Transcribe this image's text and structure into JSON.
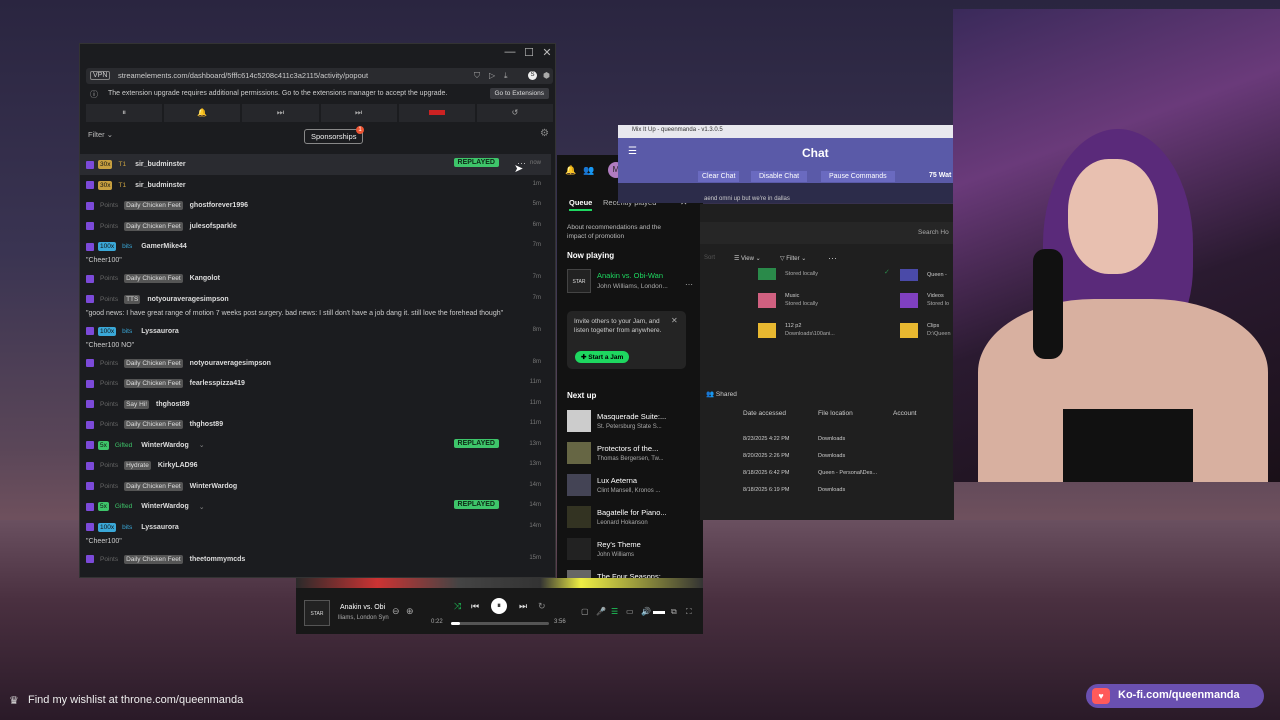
{
  "streamelements": {
    "url": "streamelements.com/dashboard/5fffc614c5208c411c3a2115/activity/popout",
    "vpn": "VPN",
    "notice": "The extension upgrade requires additional permissions. Go to the extensions manager to accept the upgrade.",
    "notice_button": "Go to Extensions",
    "filter": "Filter",
    "sponsorships": "Sponsorships",
    "badge_count": "1",
    "feed": [
      {
        "b1": "30x",
        "b2": "T1",
        "name": "sir_budminster",
        "msg": "",
        "time": "now",
        "replayed": "REPLAYED",
        "kind": "sub"
      },
      {
        "b1": "30x",
        "b2": "T1",
        "name": "sir_budminster",
        "msg": "",
        "time": "1m",
        "replayed": "",
        "kind": "sub"
      },
      {
        "b1": "Points",
        "b2": "Daily Chicken Feet",
        "name": "ghostforever1996",
        "msg": "",
        "time": "5m",
        "replayed": "",
        "kind": "points"
      },
      {
        "b1": "Points",
        "b2": "Daily Chicken Feet",
        "name": "julesofsparkle",
        "msg": "",
        "time": "6m",
        "replayed": "",
        "kind": "points"
      },
      {
        "b1": "100x",
        "b2": "bits",
        "name": "GamerMike44",
        "msg": "\"Cheer100\"",
        "time": "7m",
        "replayed": "",
        "kind": "bits"
      },
      {
        "b1": "Points",
        "b2": "Daily Chicken Feet",
        "name": "Kangolot",
        "msg": "",
        "time": "7m",
        "replayed": "",
        "kind": "points"
      },
      {
        "b1": "Points",
        "b2": "TTS",
        "name": "notyouraveragesimpson",
        "msg": "\"good news: I have great range of motion 7 weeks post surgery. bad news: I still don't have a job dang it. still love the forehead though\"",
        "time": "7m",
        "replayed": "",
        "kind": "points"
      },
      {
        "b1": "100x",
        "b2": "bits",
        "name": "Lyssaurora",
        "msg": "\"Cheer100 NO\"",
        "time": "8m",
        "replayed": "",
        "kind": "bits"
      },
      {
        "b1": "Points",
        "b2": "Daily Chicken Feet",
        "name": "notyouraveragesimpson",
        "msg": "",
        "time": "8m",
        "replayed": "",
        "kind": "points"
      },
      {
        "b1": "Points",
        "b2": "Daily Chicken Feet",
        "name": "fearlesspizza419",
        "msg": "",
        "time": "11m",
        "replayed": "",
        "kind": "points"
      },
      {
        "b1": "Points",
        "b2": "Say Hi!",
        "name": "thghost89",
        "msg": "",
        "time": "11m",
        "replayed": "",
        "kind": "points"
      },
      {
        "b1": "Points",
        "b2": "Daily Chicken Feet",
        "name": "thghost89",
        "msg": "",
        "time": "11m",
        "replayed": "",
        "kind": "points"
      },
      {
        "b1": "5x",
        "b2": "Gifted",
        "name": "WinterWardog",
        "msg": "",
        "time": "13m",
        "replayed": "REPLAYED",
        "kind": "gift"
      },
      {
        "b1": "Points",
        "b2": "Hydrate",
        "name": "KirkyLAD96",
        "msg": "",
        "time": "13m",
        "replayed": "",
        "kind": "points"
      },
      {
        "b1": "Points",
        "b2": "Daily Chicken Feet",
        "name": "WinterWardog",
        "msg": "",
        "time": "14m",
        "replayed": "",
        "kind": "points"
      },
      {
        "b1": "5x",
        "b2": "Gifted",
        "name": "WinterWardog",
        "msg": "",
        "time": "14m",
        "replayed": "REPLAYED",
        "kind": "gift"
      },
      {
        "b1": "100x",
        "b2": "bits",
        "name": "Lyssaurora",
        "msg": "\"Cheer100\"",
        "time": "14m",
        "replayed": "",
        "kind": "bits"
      },
      {
        "b1": "Points",
        "b2": "Daily Chicken Feet",
        "name": "theetommymcds",
        "msg": "",
        "time": "15m",
        "replayed": "",
        "kind": "points"
      }
    ]
  },
  "spotify": {
    "avatar": "M",
    "tab_queue": "Queue",
    "tab_recent": "Recently played",
    "about": "About recommendations and the impact of promotion",
    "now_playing_label": "Now playing",
    "now_title": "Anakin vs. Obi-Wan",
    "now_artist": "John Williams, London...",
    "jam_text": "Invite others to your Jam, and listen together from anywhere.",
    "jam_button": "Start a Jam",
    "next_up_label": "Next up",
    "next_up": [
      {
        "title": "Masquerade Suite:...",
        "artist": "St. Petersburg State S..."
      },
      {
        "title": "Protectors of the...",
        "artist": "Thomas Bergersen, Tw..."
      },
      {
        "title": "Lux Aeterna",
        "artist": "Clint Mansell, Kronos ..."
      },
      {
        "title": "Bagatelle for Piano...",
        "artist": "Leonard Hokanson"
      },
      {
        "title": "Rey's Theme",
        "artist": "John Williams"
      },
      {
        "title": "The Four Seasons:...",
        "artist": "Antonio Vivaldi, Adria..."
      }
    ],
    "player_title": "Anakin vs. Obi",
    "player_artist": "lliams, London Syn",
    "time_elapsed": "0:22",
    "time_total": "3:56",
    "progress": 0.09
  },
  "mixitup": {
    "title": "Mix It Up - queenmanda - v1.3.0.5",
    "header": "Chat",
    "buttons": [
      "Clear Chat",
      "Disable Chat",
      "Pause Commands"
    ],
    "watching": "75 Wat",
    "chat_snip": "aend omni up but we're in dallas"
  },
  "explorer": {
    "search": "Search Ho",
    "view": "View",
    "filter": "Filter",
    "items": [
      {
        "name": "",
        "sub": "Stored locally"
      },
      {
        "name": "Queen - ",
        "sub": ""
      },
      {
        "name": "Music",
        "sub": "Stored locally"
      },
      {
        "name": "Videos",
        "sub": "Stored lo"
      },
      {
        "name": "112 p2",
        "sub": "Downloads\\100ani..."
      },
      {
        "name": "Clips",
        "sub": "D:\\Queen"
      }
    ],
    "shared_tab": "Shared",
    "cols": [
      "Date accessed",
      "File location",
      "Account"
    ],
    "rows": [
      {
        "date": "8/23/2025 4:22 PM",
        "loc": "Downloads"
      },
      {
        "date": "8/20/2025 2:26 PM",
        "loc": "Downloads"
      },
      {
        "date": "8/18/2025 6:42 PM",
        "loc": "Queen - Personal\\Des..."
      },
      {
        "date": "8/18/2025 6:19 PM",
        "loc": "Downloads"
      }
    ]
  },
  "overlay": {
    "wishlist": "Find my wishlist at throne.com/queenmanda",
    "kofi": "Ko-fi.com/queenmanda"
  },
  "colors": {
    "replayed": "#3ec56a",
    "twitch": "#7c4ad9",
    "spotify_green": "#1ed760"
  }
}
